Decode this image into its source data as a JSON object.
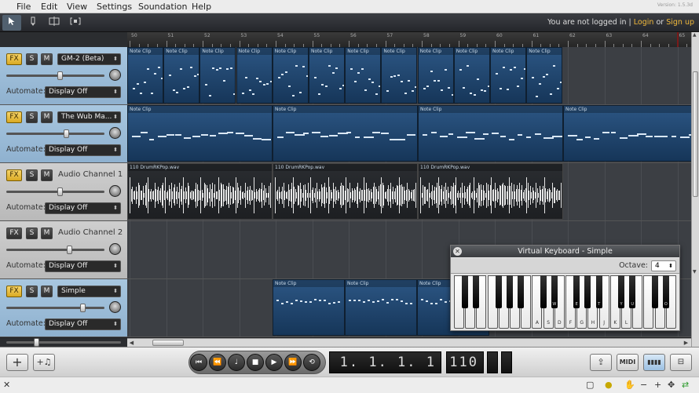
{
  "menu": [
    "File",
    "Edit",
    "View",
    "Settings",
    "Soundation",
    "Help"
  ],
  "version": "Version: 1.5.3d",
  "toolbar": {
    "tools": [
      "pointer-tool-icon",
      "pencil-tool-icon",
      "split-tool-icon",
      "loop-tool-icon"
    ]
  },
  "login": {
    "text": "You are not logged in |",
    "login": "Login",
    "or": "or",
    "signup": "Sign up"
  },
  "ruler": {
    "labels": [
      "50",
      "51",
      "52",
      "53",
      "54",
      "55",
      "56",
      "57",
      "58",
      "59",
      "60",
      "61",
      "62",
      "63",
      "64",
      "65"
    ]
  },
  "tracks": [
    {
      "fx": "FX",
      "s": "S",
      "m": "M",
      "name": "GM-2 (Beta)",
      "is_select": true,
      "automate": "Automate:",
      "automate_value": "Display Off",
      "volume": 0.55,
      "fx_active": true,
      "style": "blue"
    },
    {
      "fx": "FX",
      "s": "S",
      "m": "M",
      "name": "The Wub Ma...",
      "is_select": true,
      "automate": "Automate:",
      "automate_value": "Display Off",
      "volume": 0.62,
      "fx_active": true,
      "style": "blue"
    },
    {
      "fx": "FX",
      "s": "S",
      "m": "M",
      "name": "Audio Channel 1",
      "is_select": false,
      "automate": "Automate:",
      "automate_value": "Display Off",
      "volume": 0.55,
      "fx_active": true,
      "style": "gray"
    },
    {
      "fx": "FX",
      "s": "S",
      "m": "M",
      "name": "Audio Channel 2",
      "is_select": false,
      "automate": "Automate:",
      "automate_value": "Display Off",
      "volume": 0.65,
      "fx_active": false,
      "style": "gray"
    },
    {
      "fx": "FX",
      "s": "S",
      "m": "M",
      "name": "Simple",
      "is_select": true,
      "automate": "Automate:",
      "automate_value": "Display Off",
      "volume": 0.8,
      "fx_active": true,
      "style": "blue"
    }
  ],
  "clips": {
    "note_label": "Note Clip",
    "audio_label": "110 DrumRKPop.wav"
  },
  "transport": {
    "position": "1. 1. 1.    1",
    "tempo": "110"
  },
  "virtual_keyboard": {
    "title": "Virtual Keyboard - Simple",
    "octave_label": "Octave:",
    "octave_value": "4",
    "white_key_labels": [
      "",
      "",
      "",
      "",
      "",
      "",
      "",
      "A",
      "S",
      "D",
      "F",
      "G",
      "H",
      "J",
      "K",
      "L",
      "",
      "",
      "",
      ""
    ],
    "black_key_labels": [
      "",
      "",
      "",
      "",
      "",
      "",
      "W",
      "E",
      "",
      "T",
      "Y",
      "U",
      "",
      "O",
      "P",
      ""
    ]
  },
  "colors": {
    "accent": "#f0b83a",
    "clip_blue": "#2c5684",
    "header_blue": "#a8c7e0"
  }
}
